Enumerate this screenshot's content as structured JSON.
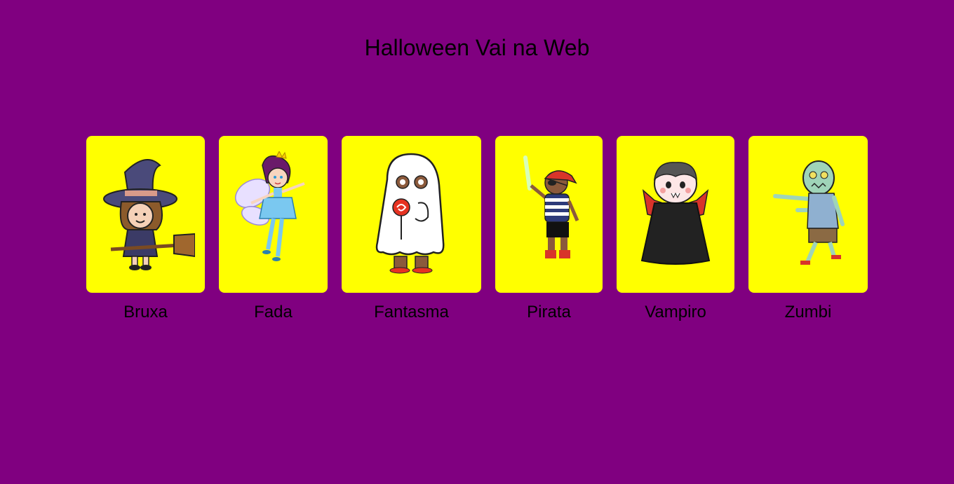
{
  "page": {
    "title": "Halloween Vai na Web",
    "background_color": "#800080",
    "card_color": "#ffff00"
  },
  "cards": [
    {
      "label": "Bruxa",
      "icon": "witch-illustration"
    },
    {
      "label": "Fada",
      "icon": "fairy-illustration"
    },
    {
      "label": "Fantasma",
      "icon": "ghost-illustration"
    },
    {
      "label": "Pirata",
      "icon": "pirate-illustration"
    },
    {
      "label": "Vampiro",
      "icon": "vampire-illustration"
    },
    {
      "label": "Zumbi",
      "icon": "zombie-illustration"
    }
  ]
}
